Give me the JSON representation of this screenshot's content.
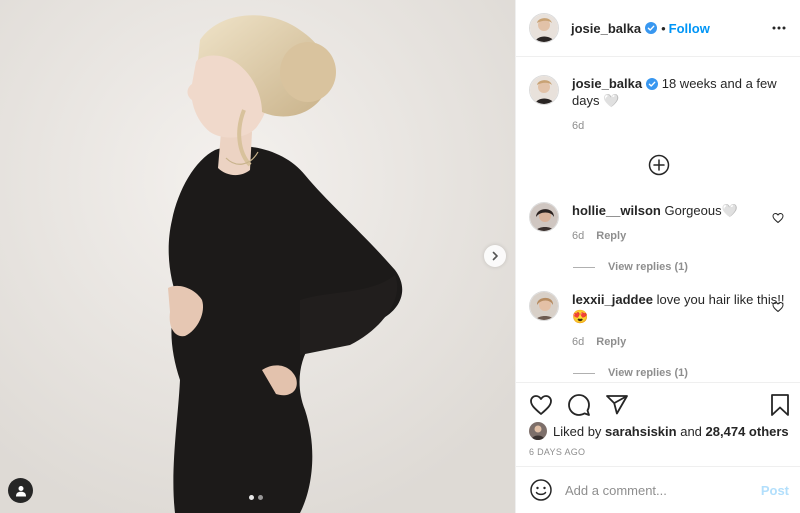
{
  "post": {
    "author": "josie_balka",
    "follow_label": "Follow",
    "separator": "•",
    "verified": true,
    "carousel": {
      "total": 2,
      "current": 1
    }
  },
  "caption": {
    "username": "josie_balka",
    "text": "18 weeks and a few days 🤍",
    "time": "6d"
  },
  "comments": [
    {
      "username": "hollie__wilson",
      "text": "Gorgeous🤍",
      "time": "6d",
      "reply_label": "Reply",
      "view_replies": "View replies (1)"
    },
    {
      "username": "lexxii_jaddee",
      "text": "love you hair like this!!😍",
      "time": "6d",
      "reply_label": "Reply",
      "view_replies": "View replies (1)"
    }
  ],
  "likes": {
    "prefix": "Liked by",
    "user": "sarahsiskin",
    "conjunction": "and",
    "others": "28,474 others"
  },
  "timestamp": "6 DAYS AGO",
  "composer": {
    "placeholder": "Add a comment...",
    "post_label": "Post"
  },
  "icons": {
    "like": "heart-icon",
    "comment": "comment-bubble-icon",
    "share": "paper-plane-icon",
    "save": "bookmark-icon",
    "emoji": "emoji-smiley-icon",
    "more": "more-horizontal-icon",
    "next": "chevron-right-icon",
    "load_more": "plus-circle-icon",
    "tag": "user-tag-icon"
  },
  "colors": {
    "accent": "#0095f6",
    "post_disabled": "#b2dffc",
    "muted": "#8e8e8e",
    "text": "#262626"
  }
}
